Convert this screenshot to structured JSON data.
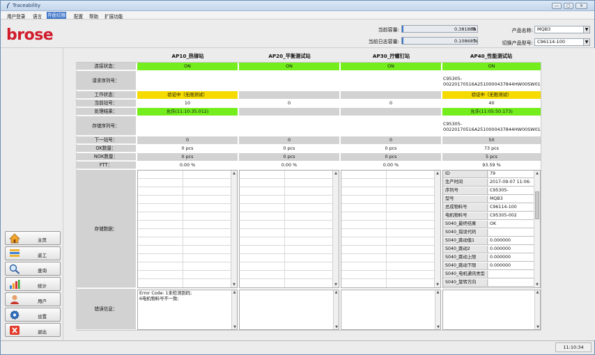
{
  "window": {
    "title": "Traceability",
    "icon": "feather-icon",
    "buttons": [
      "—",
      "▢",
      "✕"
    ]
  },
  "menu": [
    "用户登录",
    "语言",
    "界面切换",
    "配置",
    "帮助",
    "扩展功能"
  ],
  "menu_active": 2,
  "header": {
    "logo": "brose",
    "capacity_label": "当前容量:",
    "capacity_value": "0.381888",
    "capacity_unit": "%",
    "log_label": "当前日志容量:",
    "log_value": "0.108685",
    "log_unit": "%",
    "product_name_label": "产品名称:",
    "product_name_value": "MQB3",
    "switch_model_label": "切换产品型号:",
    "switch_model_value": "C96114-100"
  },
  "stations": [
    "AP10_热铆站",
    "AP20_平衡测试站",
    "AP30_拧螺钉站",
    "AP40_性能测试站"
  ],
  "row_labels": {
    "conn": "连接状态：",
    "req": "请求序列号：",
    "work": "工作状态：",
    "cur": "当前站号：",
    "result": "处理结果：",
    "store": "存储序列号：",
    "next": "下一站号：",
    "ok": "OK数量：",
    "nok": "NOK数量：",
    "ftt": "FTT：",
    "data": "存储数据：",
    "err": "错误信息："
  },
  "st1": {
    "conn": "ON",
    "req": "",
    "work": "验证中（无限测试）",
    "cur": "10",
    "result": "允许(11:10:35.012)",
    "store": "",
    "next": "0",
    "ok": "0 pcs",
    "nok": "0 pcs",
    "ftt": "0.00 %",
    "err": "Error Code: 1未检测到码;\n6电机物料号不一致;"
  },
  "st2": {
    "conn": "ON",
    "req": "",
    "work": "",
    "cur": "0",
    "result": "",
    "store": "",
    "next": "0",
    "ok": "0 pcs",
    "nok": "0 pcs",
    "ftt": "0.00 %",
    "err": ""
  },
  "st3": {
    "conn": "ON",
    "req": "",
    "work": "",
    "cur": "0",
    "result": "",
    "store": "",
    "next": "0",
    "ok": "0 pcs",
    "nok": "0 pcs",
    "ftt": "0.00 %",
    "err": ""
  },
  "st4": {
    "conn": "ON",
    "req": "C95305-\n00220170516A2510000437844HW00SW01",
    "work": "验证中（无限测试）",
    "cur": "40",
    "result": "允许(11:05:50.173)",
    "store": "C95305-\n00220170516A2510000437844HW00SW01",
    "next": "50",
    "ok": "73 pcs",
    "nok": "5 pcs",
    "ftt": "93.59 %",
    "err": ""
  },
  "st4_data": [
    [
      "ID",
      "79"
    ],
    [
      "生产时间",
      "2017-09-07 11:06:"
    ],
    [
      "序列号",
      "C95305-"
    ],
    [
      "型号",
      "MQB3"
    ],
    [
      "总成物料号",
      "C96114-100"
    ],
    [
      "电机物料号",
      "C95305-002"
    ],
    [
      "S040_最终结果",
      "OK"
    ],
    [
      "S040_错误代码",
      ""
    ],
    [
      "S040_跳动值1",
      "0.000000"
    ],
    [
      "S040_跳动2",
      "0.000000"
    ],
    [
      "S040_跳动上限",
      "0.000000"
    ],
    [
      "S040_跳动下限",
      "0.000000"
    ],
    [
      "S040_电机通讯类型",
      ""
    ],
    [
      "S040_旋转方向",
      ""
    ]
  ],
  "nav": [
    {
      "label": "主页",
      "icon": "home-icon"
    },
    {
      "label": "返工",
      "icon": "rework-icon"
    },
    {
      "label": "查询",
      "icon": "search-icon"
    },
    {
      "label": "统计",
      "icon": "chart-icon"
    },
    {
      "label": "用户",
      "icon": "user-icon"
    },
    {
      "label": "设置",
      "icon": "gear-icon"
    },
    {
      "label": "退出",
      "icon": "exit-icon"
    }
  ],
  "status": {
    "time": "11:10:34"
  },
  "colors": {
    "on": "#73ee1c",
    "warn": "#f5db00",
    "brand": "#d11b2b"
  }
}
